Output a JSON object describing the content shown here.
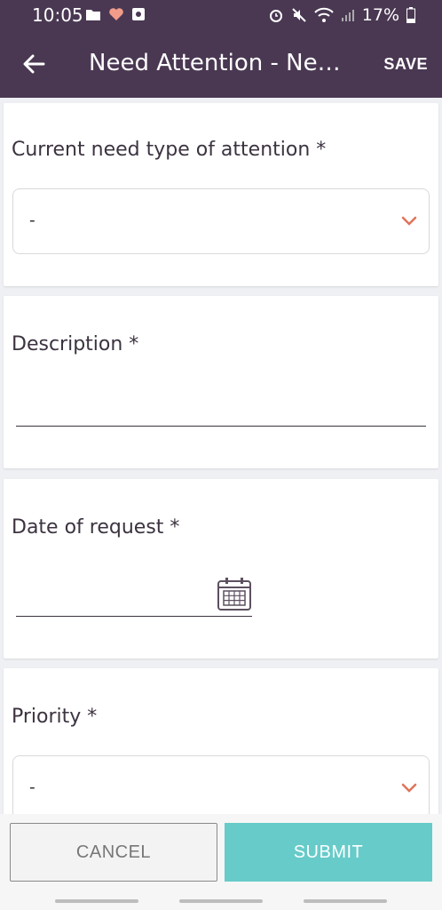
{
  "status": {
    "time": "10:05",
    "battery": "17%"
  },
  "appbar": {
    "title": "Need Attention - New...",
    "save_label": "SAVE"
  },
  "form": {
    "need_type": {
      "label": "Current need type of attention *",
      "value": "-"
    },
    "description": {
      "label": "Description *",
      "value": ""
    },
    "date": {
      "label": "Date of request *",
      "value": ""
    },
    "priority": {
      "label": "Priority *",
      "value": "-"
    }
  },
  "actions": {
    "cancel_label": "CANCEL",
    "submit_label": "SUBMIT"
  },
  "colors": {
    "header": "#4a3853",
    "accent": "#66cbc9",
    "chevron": "#e0735a"
  }
}
